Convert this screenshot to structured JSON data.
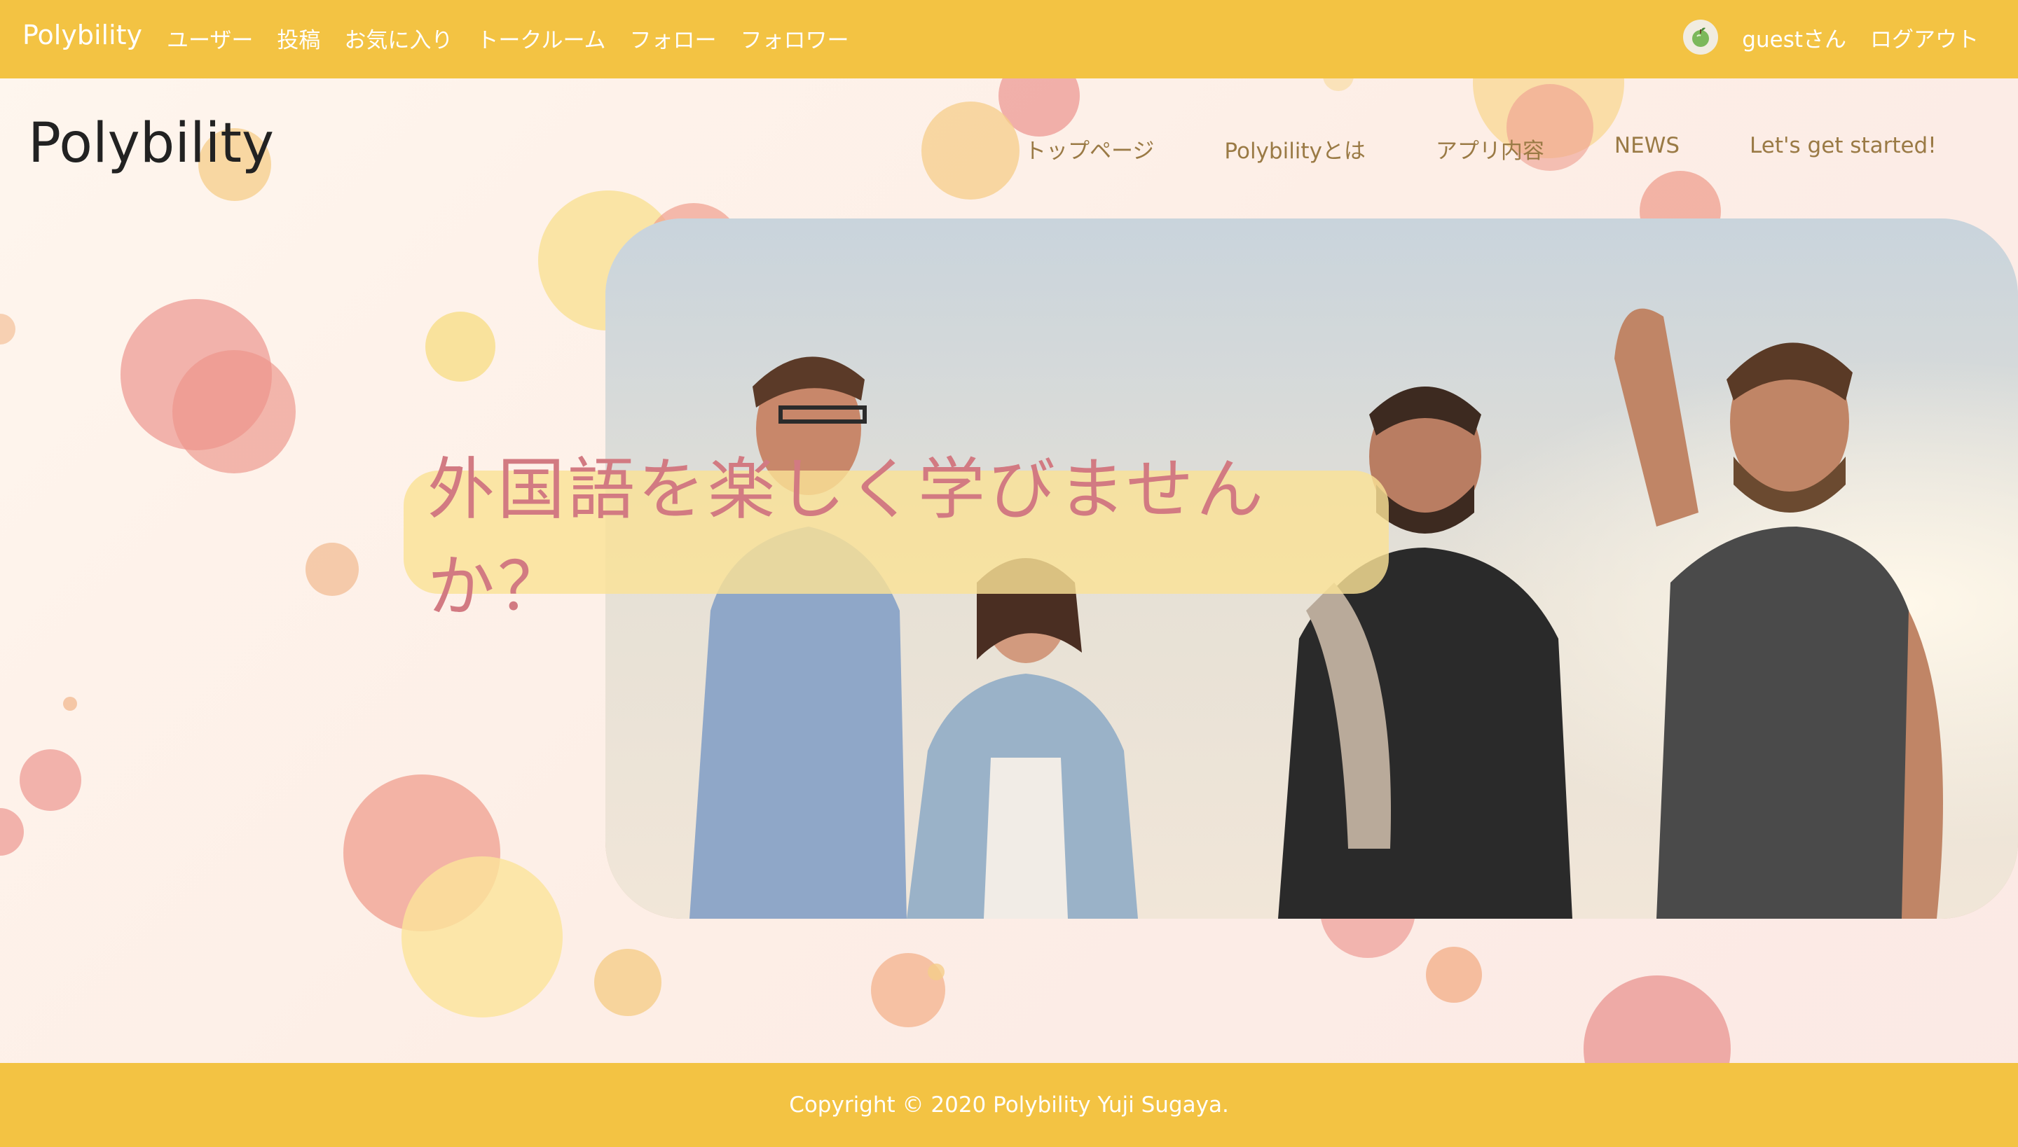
{
  "topbar": {
    "brand": "Polybility",
    "nav": [
      "ユーザー",
      "投稿",
      "お気に入り",
      "トークルーム",
      "フォロー",
      "フォロワー"
    ],
    "username": "guestさん",
    "logout": "ログアウト"
  },
  "site": {
    "logo": "Polybility",
    "nav": [
      "トップページ",
      "Polybilityとは",
      "アプリ内容",
      "NEWS",
      "Let's get started!"
    ]
  },
  "hero": {
    "catchcopy": "外国語を楽しく学びませんか？"
  },
  "footer": {
    "copyright": "Copyright © 2020 Polybility Yuji Sugaya."
  },
  "colors": {
    "accent": "#f3c343",
    "catch_text": "#d27a82",
    "site_nav_text": "#9a7a45"
  },
  "icons": {
    "avatar": "apple-avatar-icon"
  }
}
